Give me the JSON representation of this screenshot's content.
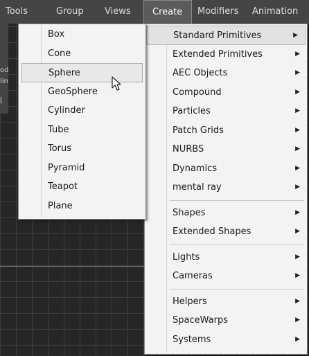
{
  "menubar": {
    "items": [
      "Tools",
      "Group",
      "Views",
      "Create",
      "Modifiers",
      "Animation"
    ],
    "active": "Create"
  },
  "left_strip": {
    "lines": [
      "od",
      "lin",
      "[ "
    ]
  },
  "create_menu": {
    "groups": [
      [
        "Standard Primitives",
        "Extended Primitives",
        "AEC Objects",
        "Compound",
        "Particles",
        "Patch Grids",
        "NURBS",
        "Dynamics",
        "mental ray"
      ],
      [
        "Shapes",
        "Extended Shapes"
      ],
      [
        "Lights",
        "Cameras"
      ],
      [
        "Helpers",
        "SpaceWarps",
        "Systems"
      ]
    ],
    "highlighted": "Standard Primitives",
    "submenu_arrow": "▶"
  },
  "standard_primitives_menu": {
    "items": [
      "Box",
      "Cone",
      "Sphere",
      "GeoSphere",
      "Cylinder",
      "Tube",
      "Torus",
      "Pyramid",
      "Teapot",
      "Plane"
    ],
    "highlighted": "Sphere"
  },
  "colors": {
    "menubar_bg": "#454545",
    "menu_bg": "#f3f3f3",
    "highlight_bg": "#e2e2e2",
    "viewport_bg": "#262626"
  }
}
